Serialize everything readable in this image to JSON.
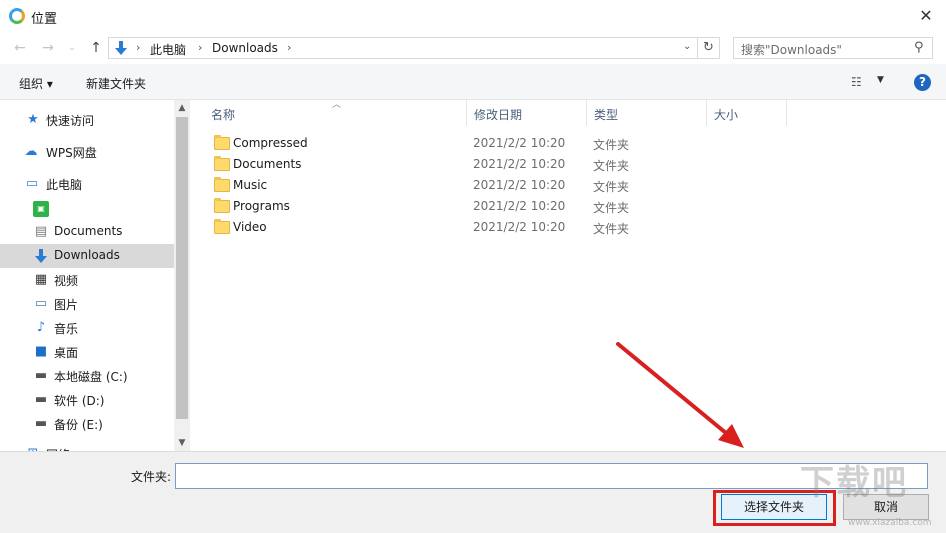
{
  "window": {
    "title": "位置"
  },
  "address": {
    "crumbs": [
      "此电脑",
      "Downloads"
    ],
    "search_placeholder": "搜索\"Downloads\""
  },
  "toolbar": {
    "organize_label": "组织 ▾",
    "new_folder_label": "新建文件夹"
  },
  "sidebar": {
    "items": [
      {
        "label": "快速访问",
        "icon": "star-icon"
      },
      {
        "label": "WPS网盘",
        "icon": "cloud-icon"
      },
      {
        "label": "此电脑",
        "icon": "computer-icon"
      },
      {
        "label": "",
        "icon": "green-app-icon"
      },
      {
        "label": "Documents",
        "icon": "documents-icon"
      },
      {
        "label": "Downloads",
        "icon": "download-icon",
        "selected": true
      },
      {
        "label": "视频",
        "icon": "video-icon"
      },
      {
        "label": "图片",
        "icon": "picture-icon"
      },
      {
        "label": "音乐",
        "icon": "music-icon"
      },
      {
        "label": "桌面",
        "icon": "desktop-icon"
      },
      {
        "label": "本地磁盘 (C:)",
        "icon": "drive-c-icon"
      },
      {
        "label": "软件 (D:)",
        "icon": "drive-icon"
      },
      {
        "label": "备份 (E:)",
        "icon": "drive-icon"
      },
      {
        "label": "网络",
        "icon": "network-icon"
      }
    ]
  },
  "filelist": {
    "columns": [
      "名称",
      "修改日期",
      "类型",
      "大小"
    ],
    "rows": [
      {
        "name": "Compressed",
        "date": "2021/2/2 10:20",
        "type": "文件夹"
      },
      {
        "name": "Documents",
        "date": "2021/2/2 10:20",
        "type": "文件夹"
      },
      {
        "name": "Music",
        "date": "2021/2/2 10:20",
        "type": "文件夹"
      },
      {
        "name": "Programs",
        "date": "2021/2/2 10:20",
        "type": "文件夹"
      },
      {
        "name": "Video",
        "date": "2021/2/2 10:20",
        "type": "文件夹"
      }
    ]
  },
  "bottom": {
    "folder_label": "文件夹:",
    "folder_value": "",
    "select_button": "选择文件夹",
    "cancel_button": "取消"
  },
  "watermark": {
    "text": "下载吧",
    "sub": "www.xiazaiba.com"
  },
  "colors": {
    "highlight": "#d8211e",
    "selected_bg": "#d9d9d9",
    "accent": "#0078d7"
  }
}
